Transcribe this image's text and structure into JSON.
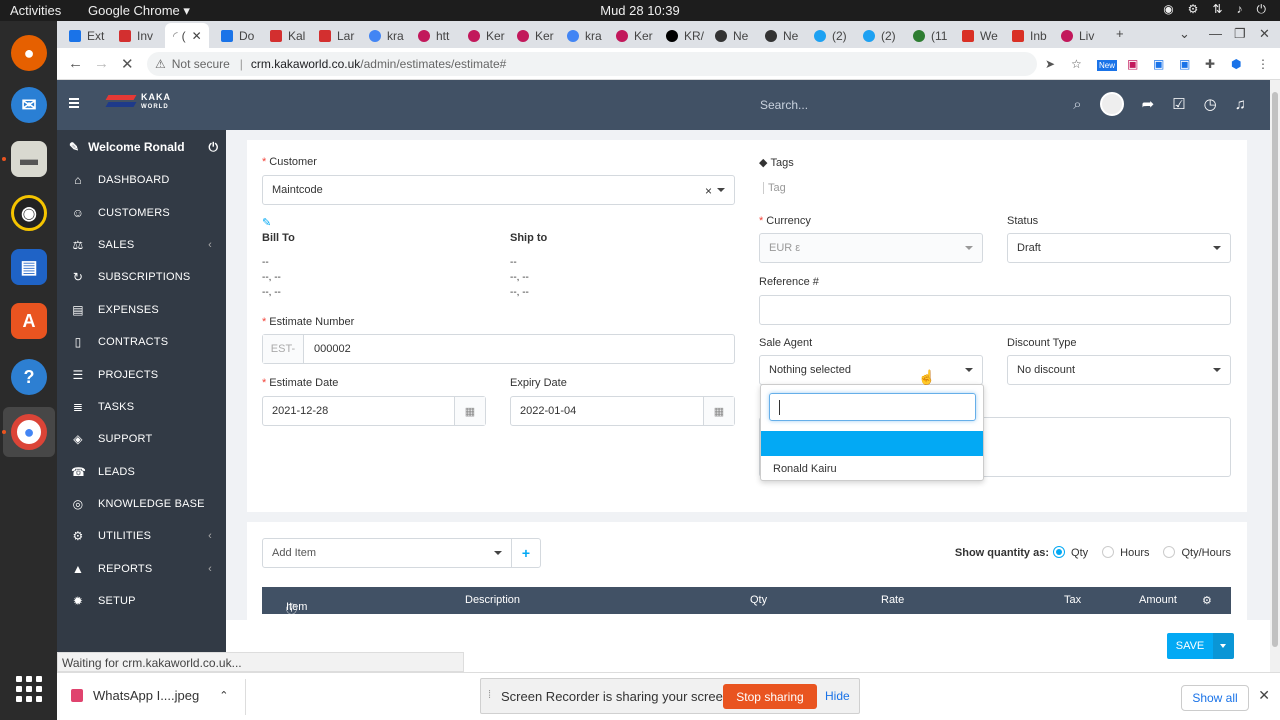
{
  "os": {
    "activities": "Activities",
    "app": "Google Chrome ▾",
    "clock": "Mud 28  10:39"
  },
  "browser": {
    "tabs": [
      "Ext",
      "Inv",
      "(",
      "Do",
      "Kal",
      "Lar",
      "kra",
      "htt",
      "Ker",
      "Ker",
      "kra",
      "Ker",
      "KR/",
      "Ne",
      "Ne",
      "(2)",
      "(2)",
      "(11",
      "We",
      "Inb",
      "Liv"
    ],
    "not_secure": "Not secure",
    "url_host": "crm.kakaworld.co.uk",
    "url_path": "/admin/estimates/estimate#",
    "ext_new": "New",
    "status": "Waiting for crm.kakaworld.co.uk..."
  },
  "app": {
    "logo_line1": "KAKA",
    "logo_line2": "WORLD",
    "search_placeholder": "Search...",
    "welcome": "Welcome Ronald",
    "menu": [
      {
        "label": "DASHBOARD",
        "icon": "⌂",
        "arrow": ""
      },
      {
        "label": "CUSTOMERS",
        "icon": "☺",
        "arrow": ""
      },
      {
        "label": "SALES",
        "icon": "⚖",
        "arrow": "‹"
      },
      {
        "label": "SUBSCRIPTIONS",
        "icon": "↻",
        "arrow": ""
      },
      {
        "label": "EXPENSES",
        "icon": "▤",
        "arrow": ""
      },
      {
        "label": "CONTRACTS",
        "icon": "▯",
        "arrow": ""
      },
      {
        "label": "PROJECTS",
        "icon": "☰",
        "arrow": ""
      },
      {
        "label": "TASKS",
        "icon": "≣",
        "arrow": ""
      },
      {
        "label": "SUPPORT",
        "icon": "◈",
        "arrow": ""
      },
      {
        "label": "LEADS",
        "icon": "☎",
        "arrow": ""
      },
      {
        "label": "KNOWLEDGE BASE",
        "icon": "◎",
        "arrow": ""
      },
      {
        "label": "UTILITIES",
        "icon": "⚙",
        "arrow": "‹"
      },
      {
        "label": "REPORTS",
        "icon": "▲",
        "arrow": "‹"
      },
      {
        "label": "SETUP",
        "icon": "✹",
        "arrow": ""
      }
    ]
  },
  "form": {
    "customer_label": "Customer",
    "customer_value": "Maintcode",
    "clear": "×",
    "bill_to": "Bill To",
    "ship_to": "Ship to",
    "addr_line1": "--",
    "addr_line2": "--, --",
    "addr_line3": "--, --",
    "estimate_number_label": "Estimate Number",
    "estimate_prefix": "EST-",
    "estimate_number": "000002",
    "estimate_date_label": "Estimate Date",
    "estimate_date": "2021-12-28",
    "expiry_date_label": "Expiry Date",
    "expiry_date": "2022-01-04",
    "tags_label": "Tags",
    "tag_placeholder": "Tag",
    "currency_label": "Currency",
    "currency_value": "EUR ε",
    "status_label": "Status",
    "status_value": "Draft",
    "reference_label": "Reference #",
    "sale_agent_label": "Sale Agent",
    "sale_agent_value": "Nothing selected",
    "discount_type_label": "Discount Type",
    "discount_type_value": "No discount",
    "agent_options": [
      "",
      "Ronald Kairu"
    ]
  },
  "items": {
    "add_item": "Add Item",
    "show_qty_label": "Show quantity as:",
    "qty_options": [
      "Qty",
      "Hours",
      "Qty/Hours"
    ],
    "selected_qty": "Qty",
    "columns": [
      "Item",
      "Description",
      "Qty",
      "Rate",
      "Tax",
      "Amount"
    ],
    "save": "SAVE"
  },
  "downloads": {
    "file": "WhatsApp I....jpeg",
    "show_all": "Show all"
  },
  "screen_share": {
    "text": "Screen Recorder is sharing your screen.",
    "stop": "Stop sharing",
    "hide": "Hide"
  },
  "colors": {
    "header": "#415165",
    "sidebar": "#323a45",
    "accent": "#03a9f4",
    "ubuntu_orange": "#e95420"
  }
}
